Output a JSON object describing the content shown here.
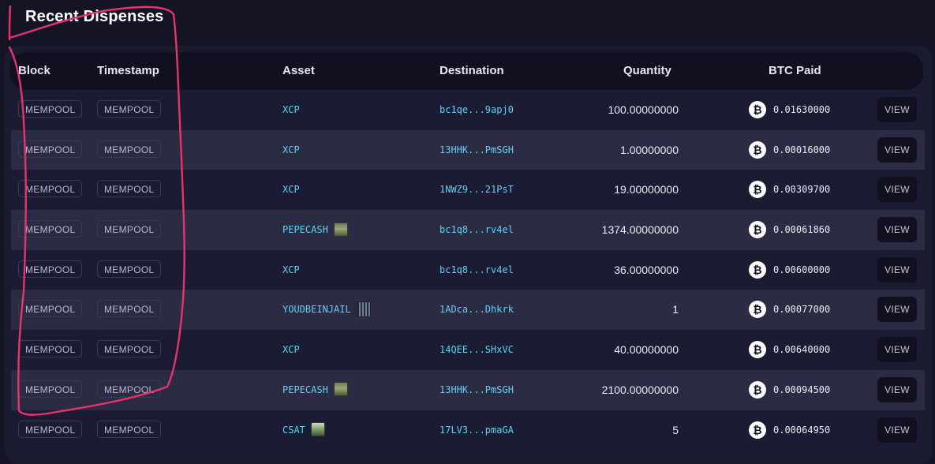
{
  "section": {
    "title": "Recent Dispenses"
  },
  "table": {
    "headers": {
      "block": "Block",
      "timestamp": "Timestamp",
      "asset": "Asset",
      "destination": "Destination",
      "quantity": "Quantity",
      "btc_paid": "BTC Paid"
    },
    "rows": [
      {
        "block": "MEMPOOL",
        "timestamp": "MEMPOOL",
        "asset": "XCP",
        "asset_icon": "",
        "destination": "bc1qe...9apj0",
        "quantity": "100.00000000",
        "btc_paid": "0.01630000",
        "action": "VIEW"
      },
      {
        "block": "MEMPOOL",
        "timestamp": "MEMPOOL",
        "asset": "XCP",
        "asset_icon": "",
        "destination": "13HHK...PmSGH",
        "quantity": "1.00000000",
        "btc_paid": "0.00016000",
        "action": "VIEW"
      },
      {
        "block": "MEMPOOL",
        "timestamp": "MEMPOOL",
        "asset": "XCP",
        "asset_icon": "",
        "destination": "1NWZ9...21PsT",
        "quantity": "19.00000000",
        "btc_paid": "0.00309700",
        "action": "VIEW"
      },
      {
        "block": "MEMPOOL",
        "timestamp": "MEMPOOL",
        "asset": "PEPECASH",
        "asset_icon": "pepe-card-thumbnail",
        "destination": "bc1q8...rv4el",
        "quantity": "1374.00000000",
        "btc_paid": "0.00061860",
        "action": "VIEW"
      },
      {
        "block": "MEMPOOL",
        "timestamp": "MEMPOOL",
        "asset": "XCP",
        "asset_icon": "",
        "destination": "bc1q8...rv4el",
        "quantity": "36.00000000",
        "btc_paid": "0.00600000",
        "action": "VIEW"
      },
      {
        "block": "MEMPOOL",
        "timestamp": "MEMPOOL",
        "asset": "YOUDBEINJAIL",
        "asset_icon": "jail-card-thumbnail",
        "destination": "1ADca...Dhkrk",
        "quantity": "1",
        "btc_paid": "0.00077000",
        "action": "VIEW"
      },
      {
        "block": "MEMPOOL",
        "timestamp": "MEMPOOL",
        "asset": "XCP",
        "asset_icon": "",
        "destination": "14QEE...SHxVC",
        "quantity": "40.00000000",
        "btc_paid": "0.00640000",
        "action": "VIEW"
      },
      {
        "block": "MEMPOOL",
        "timestamp": "MEMPOOL",
        "asset": "PEPECASH",
        "asset_icon": "pepe-card-thumbnail",
        "destination": "13HHK...PmSGH",
        "quantity": "2100.00000000",
        "btc_paid": "0.00094500",
        "action": "VIEW"
      },
      {
        "block": "MEMPOOL",
        "timestamp": "MEMPOOL",
        "asset": "CSAT",
        "asset_icon": "csat-card-thumbnail",
        "destination": "17LV3...pmaGA",
        "quantity": "5",
        "btc_paid": "0.00064950",
        "action": "VIEW"
      }
    ]
  },
  "btc_icon": {
    "name": "bitcoin-icon",
    "glyph": "₿"
  },
  "colors": {
    "background": "#141425",
    "panel": "#1b1b30",
    "row_alt": "#2b2b44",
    "link": "#5fd3f3",
    "annotation": "#e8336f"
  },
  "annotation": {
    "name": "red-freehand-circle-annotation"
  }
}
